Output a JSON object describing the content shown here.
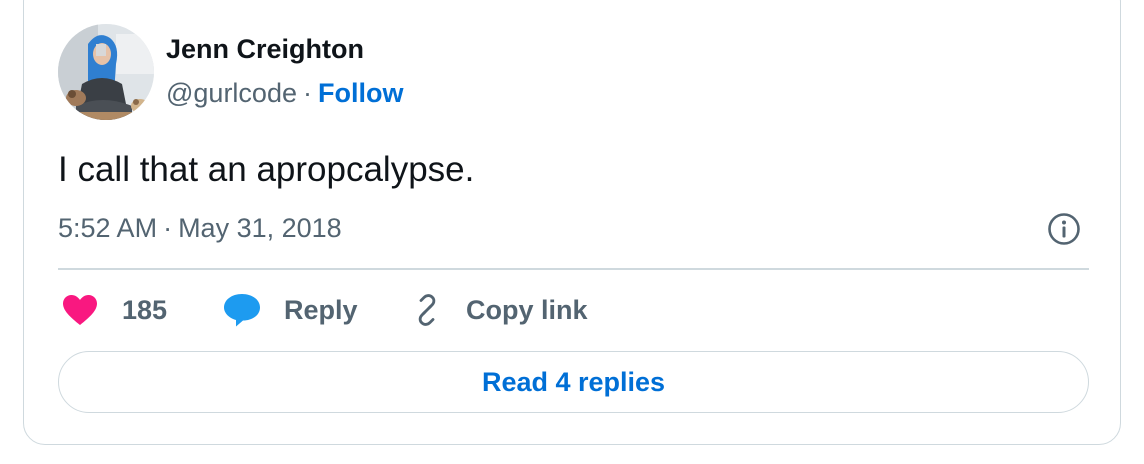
{
  "author": {
    "name": "Jenn Creighton",
    "handle": "@gurlcode",
    "separator": "·",
    "follow_label": "Follow"
  },
  "tweet": {
    "text": "I call that an apropcalypse.",
    "time": "5:52 AM",
    "separator": "·",
    "date": "May 31, 2018"
  },
  "actions": {
    "like_count": "185",
    "reply_label": "Reply",
    "copy_link_label": "Copy link",
    "read_replies_label": "Read 4 replies"
  },
  "icons": {
    "like": "heart-icon",
    "reply": "speech-bubble-icon",
    "copy_link": "link-icon",
    "info": "info-icon"
  },
  "colors": {
    "like": "#f91880",
    "reply": "#1d9bf0",
    "link": "#006fd6",
    "secondary_text": "#536471",
    "border": "#cfd9de"
  }
}
